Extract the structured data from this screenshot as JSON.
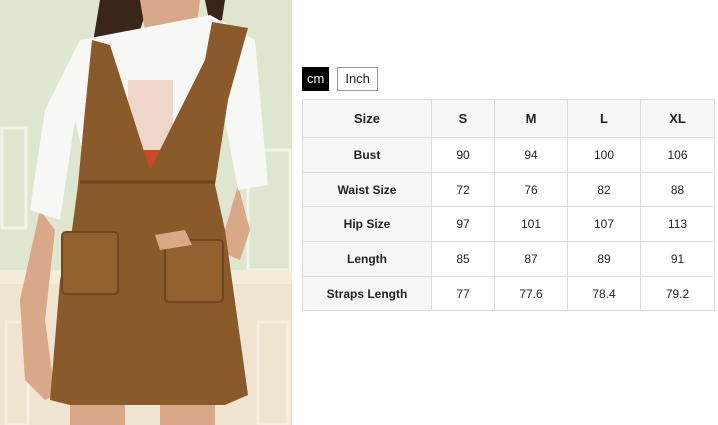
{
  "units": {
    "cm_label": "cm",
    "inch_label": "Inch",
    "active": "cm"
  },
  "photo": {
    "subject": "model wearing brown corduroy pinafore dress over white t-shirt"
  },
  "size_table": {
    "columns": [
      "Size",
      "S",
      "M",
      "L",
      "XL"
    ],
    "rows": [
      {
        "label": "Bust",
        "values": [
          "90",
          "94",
          "100",
          "106"
        ]
      },
      {
        "label": "Waist Size",
        "values": [
          "72",
          "76",
          "82",
          "88"
        ]
      },
      {
        "label": "Hip Size",
        "values": [
          "97",
          "101",
          "107",
          "113"
        ]
      },
      {
        "label": "Length",
        "values": [
          "85",
          "87",
          "89",
          "91"
        ]
      },
      {
        "label": "Straps Length",
        "values": [
          "77",
          "77.6",
          "78.4",
          "79.2"
        ]
      }
    ]
  },
  "colors": {
    "dress_brown": "#8a5a2b",
    "wall_green": "#dfe6d0",
    "header_bg": "#f6f6f6"
  }
}
